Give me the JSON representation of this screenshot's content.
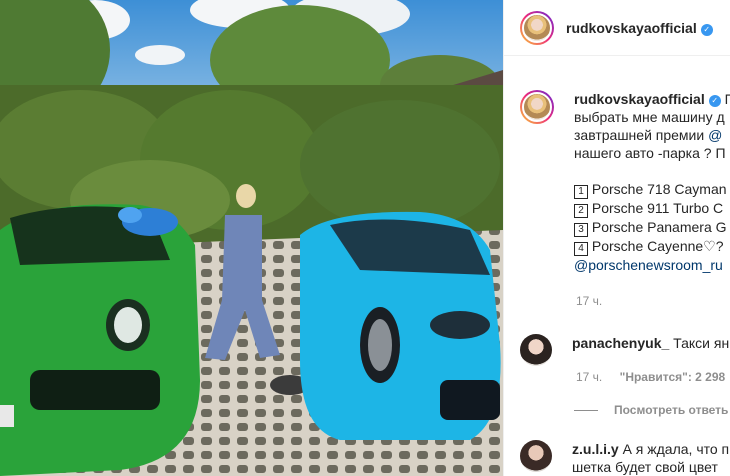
{
  "post": {
    "username": "rudkovskayaofficial",
    "verified_icon": "verified-badge-icon"
  },
  "caption": {
    "username": "rudkovskayaofficial",
    "lines": [
      "П",
      "выбрать мне машину д",
      "завтрашней премии",
      "нашего авто -парка ? П"
    ],
    "mention_at": "@",
    "list": [
      {
        "num": "1",
        "text": "Porsche 718 Cayman"
      },
      {
        "num": "2",
        "text": "Porsche 911 Turbo C"
      },
      {
        "num": "3",
        "text": "Porsche Panamera G"
      },
      {
        "num": "4",
        "text": "Porsche Cayenne♡?"
      }
    ],
    "mention_link": "@porschenewsroom_ru",
    "time": "17 ч."
  },
  "comments": [
    {
      "username": "panachenyuk_",
      "text": "Такси ян",
      "time": "17 ч.",
      "likes": "\"Нравится\": 2 298",
      "replies": "Посмотреть ответь"
    },
    {
      "username": "z.u.l.i.y",
      "text": "А я ждала, что п",
      "text2": "шетка будет свой цвет"
    }
  ],
  "colors": {
    "verified": "#3897f0",
    "link": "#00376b",
    "muted": "#8e8e8e"
  }
}
